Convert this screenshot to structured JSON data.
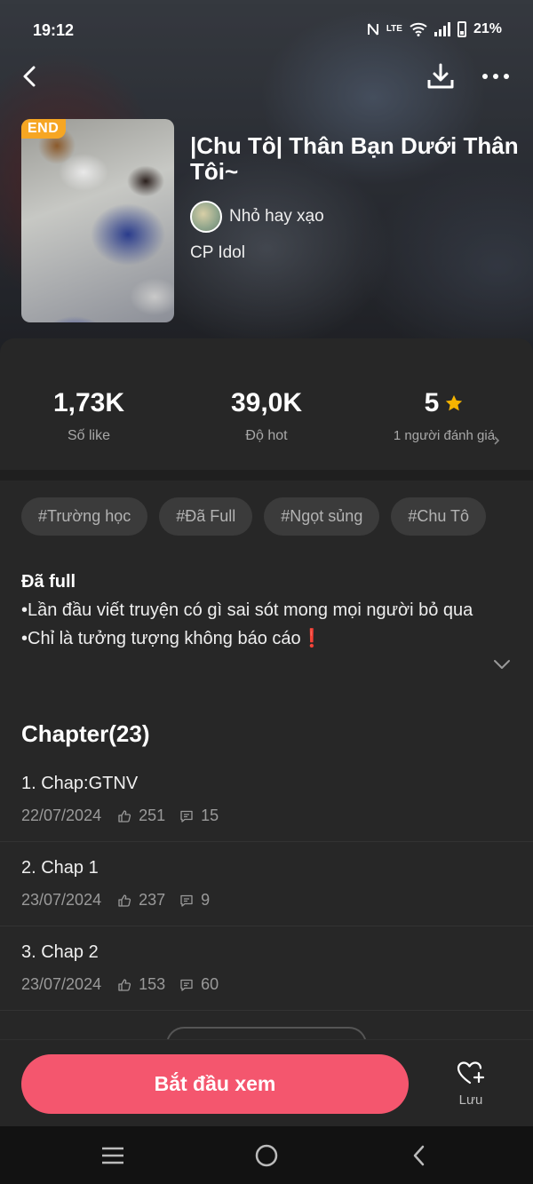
{
  "status": {
    "time": "19:12",
    "battery": "21%",
    "network": "LTE"
  },
  "book": {
    "badge": "END",
    "title": "|Chu Tô| Thân Bạn Dưới Thân Tôi~",
    "author": "Nhỏ hay xạo",
    "category": "CP Idol"
  },
  "stats": {
    "likes_value": "1,73K",
    "likes_label": "Số like",
    "hot_value": "39,0K",
    "hot_label": "Độ hot",
    "rating_value": "5",
    "rating_label": "1 người đánh giá"
  },
  "tags": [
    "#Trường học",
    "#Đã Full",
    "#Ngọt sủng",
    "#Chu Tô"
  ],
  "description": {
    "title": "Đã full",
    "line1": "•Lần đầu viết truyện có gì sai sót mong mọi người bỏ qua",
    "line2": "•Chỉ là tưởng tượng không báo cáo❗"
  },
  "chapters": {
    "header": "Chapter(23)",
    "items": [
      {
        "title": "1. Chap:GTNV",
        "date": "22/07/2024",
        "likes": "251",
        "comments": "15"
      },
      {
        "title": "2. Chap 1",
        "date": "23/07/2024",
        "likes": "237",
        "comments": "9"
      },
      {
        "title": "3. Chap 2",
        "date": "23/07/2024",
        "likes": "153",
        "comments": "60"
      }
    ]
  },
  "actions": {
    "start": "Bắt đầu xem",
    "save": "Lưu"
  },
  "colors": {
    "accent": "#f4566e",
    "badge": "#f6a623",
    "star": "#f5b400",
    "background": "#272727"
  }
}
